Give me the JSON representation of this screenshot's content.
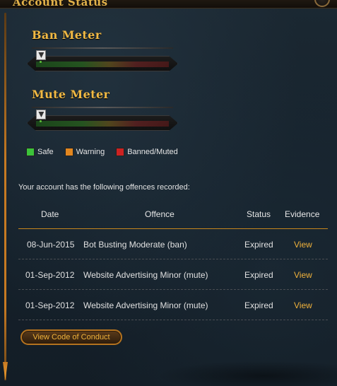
{
  "panel": {
    "title": "Account Status"
  },
  "meters": {
    "ban": {
      "title": "Ban Meter",
      "level": 0.05
    },
    "mute": {
      "title": "Mute Meter",
      "level": 0.05
    }
  },
  "legend": [
    {
      "label": "Safe",
      "color": "#3cc33a"
    },
    {
      "label": "Warning",
      "color": "#e2871f"
    },
    {
      "label": "Banned/Muted",
      "color": "#cc2222"
    }
  ],
  "intro_text": "Your account has the following offences recorded:",
  "table": {
    "headers": {
      "date": "Date",
      "offence": "Offence",
      "status": "Status",
      "evidence": "Evidence"
    },
    "rows": [
      {
        "date": "08-Jun-2015",
        "offence": "Bot Busting Moderate (ban)",
        "status": "Expired",
        "evidence": "View"
      },
      {
        "date": "01-Sep-2012",
        "offence": "Website Advertising Minor (mute)",
        "status": "Expired",
        "evidence": "View"
      },
      {
        "date": "01-Sep-2012",
        "offence": "Website Advertising Minor (mute)",
        "status": "Expired",
        "evidence": "View"
      }
    ]
  },
  "buttons": {
    "code_of_conduct": "View Code of Conduct"
  },
  "colors": {
    "accent": "#f0b23b",
    "rail": "#c77a22",
    "safe": "#3cc33a",
    "warning": "#e2871f",
    "banned": "#cc2222"
  }
}
